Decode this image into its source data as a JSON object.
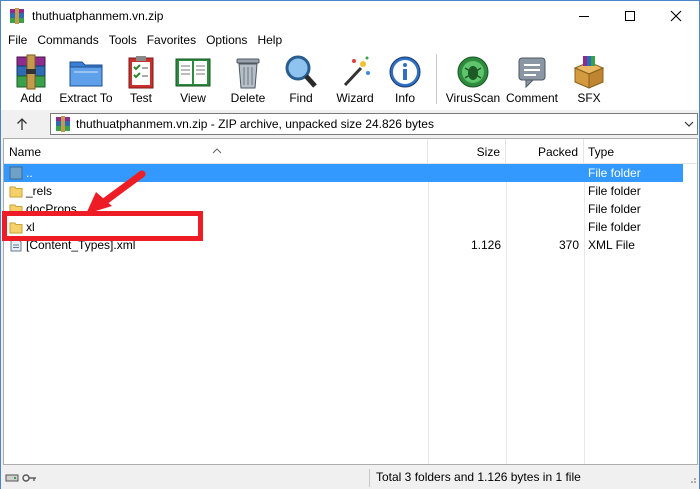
{
  "window": {
    "title": "thuthuatphanmem.vn.zip"
  },
  "menu": [
    "File",
    "Commands",
    "Tools",
    "Favorites",
    "Options",
    "Help"
  ],
  "toolbar": [
    {
      "label": "Add",
      "icon": "add-archive-icon"
    },
    {
      "label": "Extract To",
      "icon": "extract-folder-icon"
    },
    {
      "label": "Test",
      "icon": "test-clipboard-icon"
    },
    {
      "label": "View",
      "icon": "view-book-icon"
    },
    {
      "label": "Delete",
      "icon": "trash-can-icon"
    },
    {
      "label": "Find",
      "icon": "magnifier-icon"
    },
    {
      "label": "Wizard",
      "icon": "magic-wand-icon"
    },
    {
      "label": "Info",
      "icon": "info-icon"
    },
    {
      "label": "VirusScan",
      "icon": "virus-scan-icon"
    },
    {
      "label": "Comment",
      "icon": "comment-icon"
    },
    {
      "label": "SFX",
      "icon": "sfx-box-icon"
    }
  ],
  "address": {
    "text": "thuthuatphanmem.vn.zip - ZIP archive, unpacked size 24.826 bytes"
  },
  "columns": {
    "name": "Name",
    "size": "Size",
    "packed": "Packed",
    "type": "Type"
  },
  "files": [
    {
      "name": "..",
      "size": "",
      "packed": "",
      "type": "File folder",
      "selected": true,
      "kind": "parent"
    },
    {
      "name": "_rels",
      "size": "",
      "packed": "",
      "type": "File folder",
      "selected": false,
      "kind": "folder"
    },
    {
      "name": "docProps",
      "size": "",
      "packed": "",
      "type": "File folder",
      "selected": false,
      "kind": "folder"
    },
    {
      "name": "xl",
      "size": "",
      "packed": "",
      "type": "File folder",
      "selected": false,
      "kind": "folder"
    },
    {
      "name": "[Content_Types].xml",
      "size": "1.126",
      "packed": "370",
      "type": "XML File",
      "selected": false,
      "kind": "file"
    }
  ],
  "status": {
    "text": "Total 3 folders and 1.126 bytes in 1 file"
  },
  "colors": {
    "selection": "#3399ff",
    "annotation": "#ee1c25",
    "folder": "#f4d16b"
  }
}
